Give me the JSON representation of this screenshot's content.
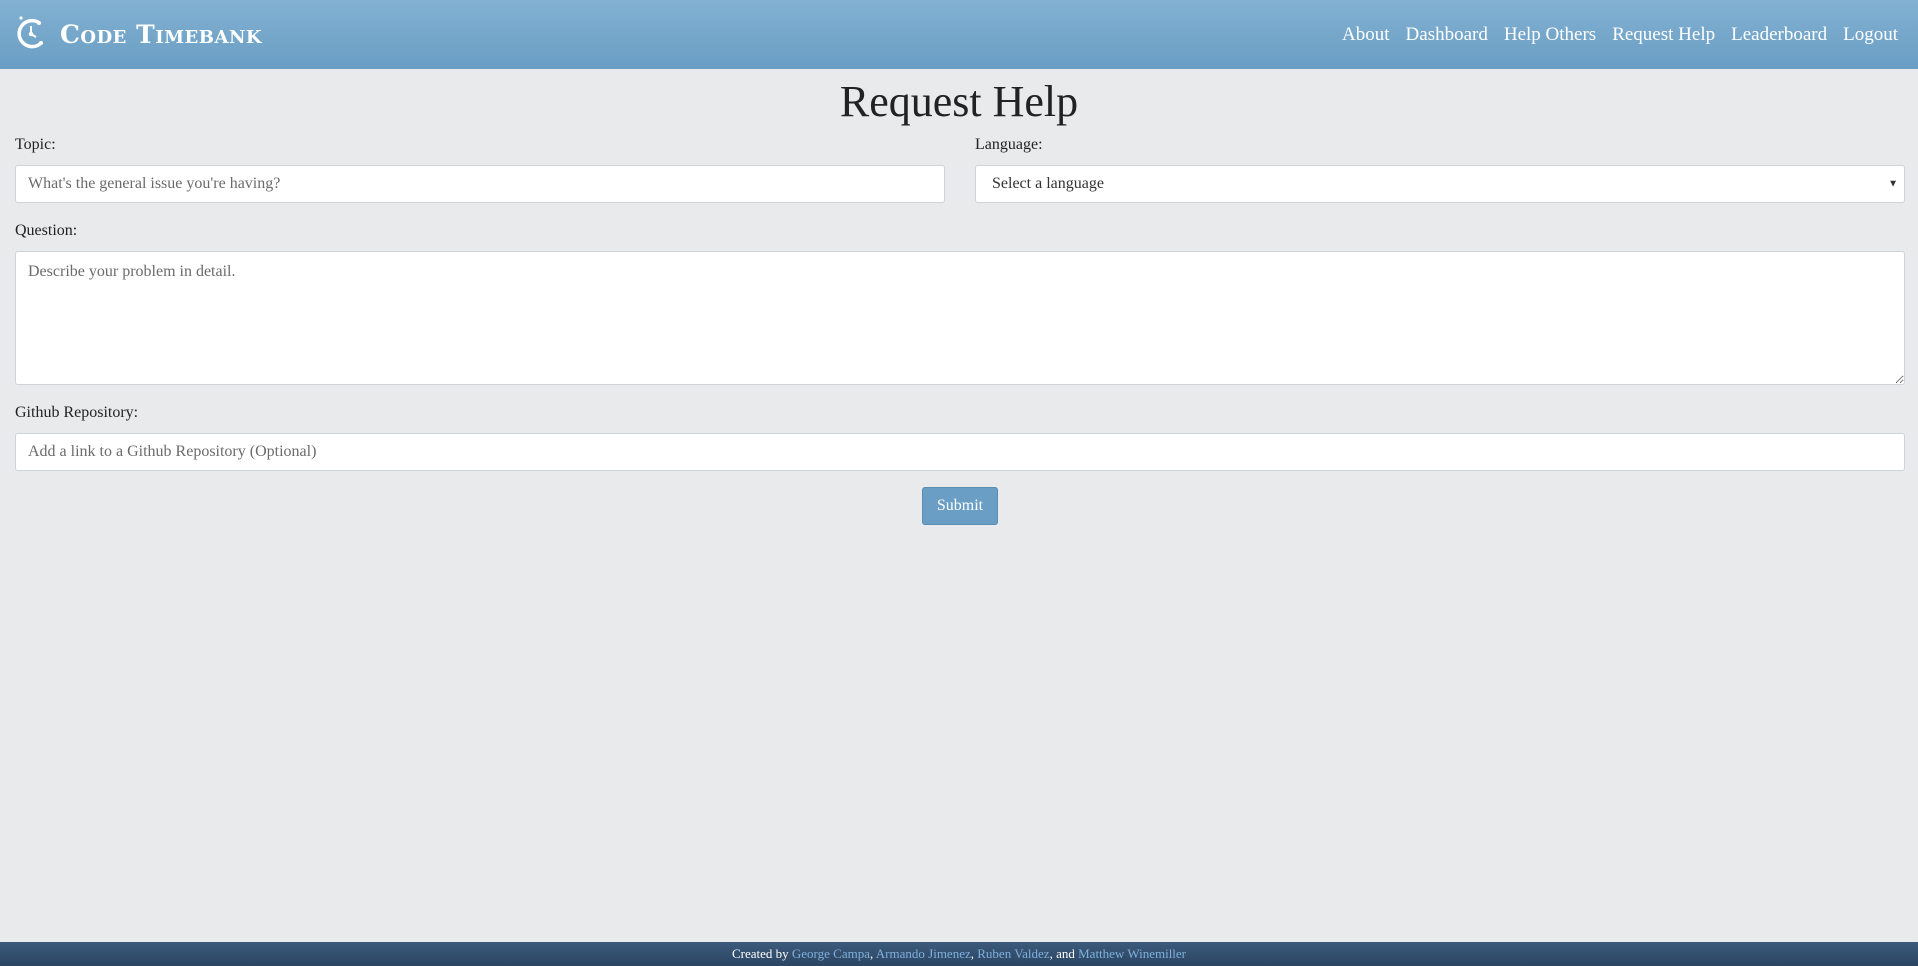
{
  "header": {
    "brand_name": "Code Timebank",
    "logo_icon": "clock-c-logo-icon",
    "nav": [
      {
        "label": "About"
      },
      {
        "label": "Dashboard"
      },
      {
        "label": "Help Others"
      },
      {
        "label": "Request Help"
      },
      {
        "label": "Leaderboard"
      },
      {
        "label": "Logout"
      }
    ]
  },
  "main": {
    "title": "Request Help",
    "topic": {
      "label": "Topic:",
      "placeholder": "What's the general issue you're having?",
      "value": ""
    },
    "language": {
      "label": "Language:",
      "selected": "Select a language"
    },
    "question": {
      "label": "Question:",
      "placeholder": "Describe your problem in detail.",
      "value": ""
    },
    "github": {
      "label": "Github Repository:",
      "placeholder": "Add a link to a Github Repository (Optional)",
      "value": ""
    },
    "submit_label": "Submit"
  },
  "footer": {
    "prefix": "Created by",
    "authors": [
      "George Campa",
      "Armando Jimenez",
      "Ruben Valdez",
      "Matthew Winemiller"
    ],
    "sep1": ", ",
    "sep2": ", ",
    "sep3": ", and "
  },
  "colors": {
    "navbar": "#6a9ec4",
    "background": "#e8eaeb",
    "footer": "#2b4563",
    "link": "#7fb0dc"
  }
}
